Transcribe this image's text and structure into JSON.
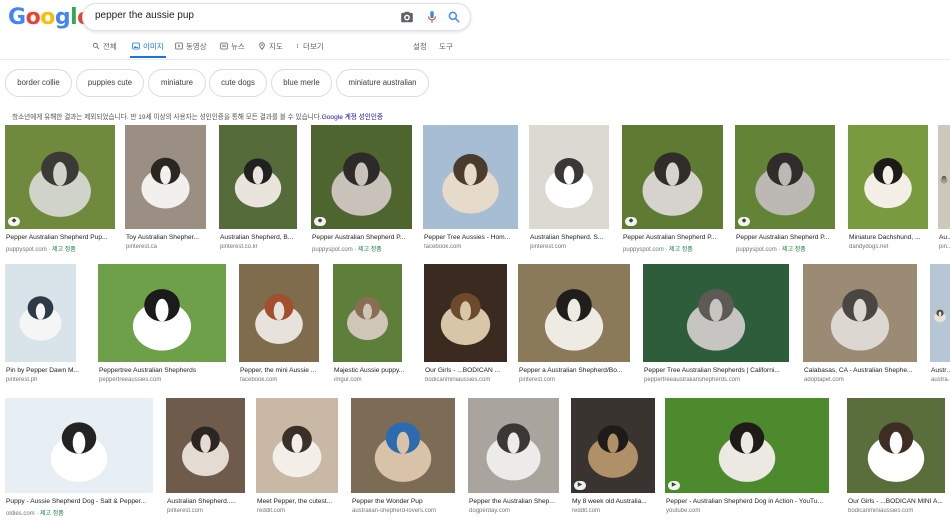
{
  "logo": {
    "letters": [
      "G",
      "o",
      "o",
      "g",
      "l",
      "e"
    ],
    "colors": [
      "#4285f4",
      "#ea4335",
      "#fbbc05",
      "#4285f4",
      "#34a853",
      "#ea4335"
    ]
  },
  "search": {
    "query": "pepper the aussie pup",
    "icons": [
      "camera-icon",
      "mic-icon",
      "search-icon"
    ]
  },
  "tabs": [
    {
      "label": "전체",
      "icon": "search-icon"
    },
    {
      "label": "이미지",
      "icon": "image-icon",
      "active": true
    },
    {
      "label": "동영상",
      "icon": "video-icon"
    },
    {
      "label": "뉴스",
      "icon": "news-icon"
    },
    {
      "label": "지도",
      "icon": "map-pin-icon"
    },
    {
      "label": "더보기",
      "icon": "more-icon"
    }
  ],
  "tools": {
    "settings": "설정",
    "tools": "도구"
  },
  "chips": [
    "border collie",
    "puppies cute",
    "miniature",
    "cute dogs",
    "blue merle",
    "miniature australian"
  ],
  "notice": {
    "text": "청소년에게 유해한 결과는 제외되었습니다. 만 19세 이상의 사용자는 성인인증을 통해 모든 결과를 볼 수 있습니다.",
    "link": "Google 계정 성인인증"
  },
  "badge_label": "제고 정품",
  "rows": [
    [
      {
        "caption": "Pepper Australian Shepherd Pup...",
        "source": "puppyspot.com",
        "badge": true,
        "pill": "◆"
      },
      {
        "caption": "Toy Australian Shepher...",
        "source": "pinterest.ca"
      },
      {
        "caption": "Australian Shepherd, B...",
        "source": "pinterest.co.kr"
      },
      {
        "caption": "Pepper Australian Shepherd P...",
        "source": "puppyspot.com",
        "badge": true,
        "pill": "◆"
      },
      {
        "caption": "Pepper Tree Aussies - Hom...",
        "source": "facebook.com"
      },
      {
        "caption": "Australian Shepherd. S...",
        "source": "pinterest.com"
      },
      {
        "caption": "Pepper Australian Shepherd P...",
        "source": "puppyspot.com",
        "badge": true,
        "pill": "◆"
      },
      {
        "caption": "Pepper Australian Shepherd P...",
        "source": "puppyspot.com",
        "badge": true,
        "pill": "◆"
      },
      {
        "caption": "Miniature Dachshund, ...",
        "source": "dandydogs.net"
      },
      {
        "caption": "Au...",
        "source": "pin..."
      }
    ],
    [
      {
        "caption": "Pin by Pepper Dawn M...",
        "source": "pinterest.ph"
      },
      {
        "caption": "Peppertree Australian Shepherds",
        "source": "peppertreeaussies.com"
      },
      {
        "caption": "Pepper, the mini Aussie ...",
        "source": "facebook.com"
      },
      {
        "caption": "Majestic Aussie puppy...",
        "source": "imgur.com"
      },
      {
        "caption": "Our Girls - ...BODICAN ...",
        "source": "bodicanminiaussies.com"
      },
      {
        "caption": "Pepper a Australian Shepherd/Bo...",
        "source": "pinterest.com"
      },
      {
        "caption": "Pepper Tree Australian Shepherds | Californi...",
        "source": "peppertreeaustralianshepherds.com"
      },
      {
        "caption": "Calabasas, CA - Australian Shephe...",
        "source": "adoptapet.com"
      },
      {
        "caption": "Austra...",
        "source": "austra..."
      }
    ],
    [
      {
        "caption": "Puppy - Aussie Shepherd Dog - Salt & Pepper...",
        "source": "oldies.com",
        "badge": true
      },
      {
        "caption": "Australian Shepherd.....",
        "source": "pinterest.com"
      },
      {
        "caption": "Meet Pepper, the cutest...",
        "source": "reddit.com"
      },
      {
        "caption": "Pepper the Wonder Pup",
        "source": "australian-shepherd-lovers.com"
      },
      {
        "caption": "Pepper the Australian Shep...",
        "source": "dogperday.com"
      },
      {
        "caption": "My 8 week old Australia...",
        "source": "reddit.com",
        "pill": "▶"
      },
      {
        "caption": "Pepper - Australian Shepherd Dog in Action - YouTu...",
        "source": "youtube.com",
        "pill": "▶"
      },
      {
        "caption": "Our Girls - ...BODICAN MINI A...",
        "source": "bodicanminiaussies.com"
      }
    ]
  ],
  "colors": {
    "accent": "#1a73e8",
    "link": "#1a0dab",
    "badge": "#188038"
  }
}
